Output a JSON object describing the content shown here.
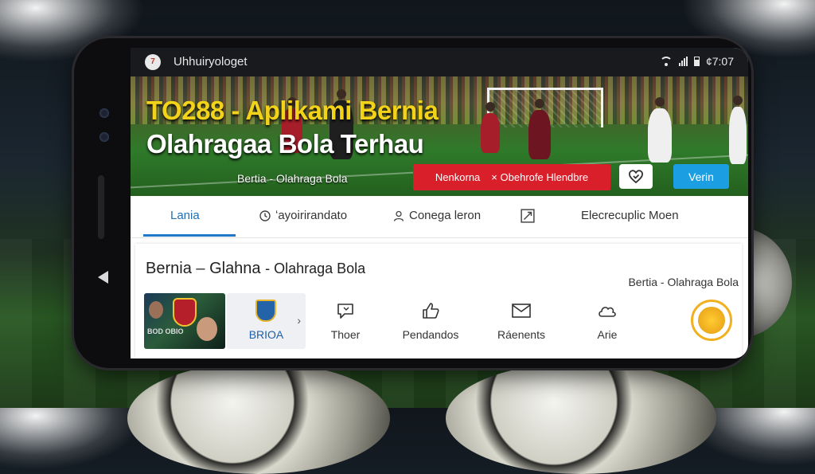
{
  "statusbar": {
    "app_icon_text": "7",
    "app_name": "Uhhuiryologet",
    "time": "¢7:07"
  },
  "banner": {
    "headline_line1": "TO288 - Aplikami Bernia",
    "headline_line2": "Olahragaa Bola Terhau",
    "subtitle": "Bertia - Olahraga Bola",
    "red_button": {
      "left_label": "Nenkorna",
      "right_label": "× Obehrofe Hlendbre"
    },
    "blue_button_label": "Verin"
  },
  "tabs": [
    {
      "label": "Lania",
      "icon": ""
    },
    {
      "label": "ʻayoirirandato",
      "icon": "clock-icon"
    },
    {
      "label": "Conega leron",
      "icon": "user-icon"
    },
    {
      "label": "",
      "icon": "expand-icon"
    },
    {
      "label": "Elecrecuplic Moen",
      "icon": ""
    }
  ],
  "content": {
    "title_part1": "Bernia",
    "title_sep": "–",
    "title_part2": "Glahna",
    "title_part3": "- Olahraga Bola",
    "right_text": "Bertia - Olahraga Bola",
    "card1_text": "BOD OBIO",
    "card2_label": "BRIOA",
    "features": [
      {
        "label": "Thoer",
        "icon": "chat-icon"
      },
      {
        "label": "Pendandos",
        "icon": "thumbs-up-icon"
      },
      {
        "label": "Ráenents",
        "icon": "mail-icon"
      },
      {
        "label": "Arie",
        "icon": "cloud-icon"
      }
    ]
  },
  "colors": {
    "accent_blue": "#1f78c8",
    "headline_yellow": "#f3d21a",
    "red_button": "#d9202a",
    "blue_button": "#1c9ee2"
  }
}
